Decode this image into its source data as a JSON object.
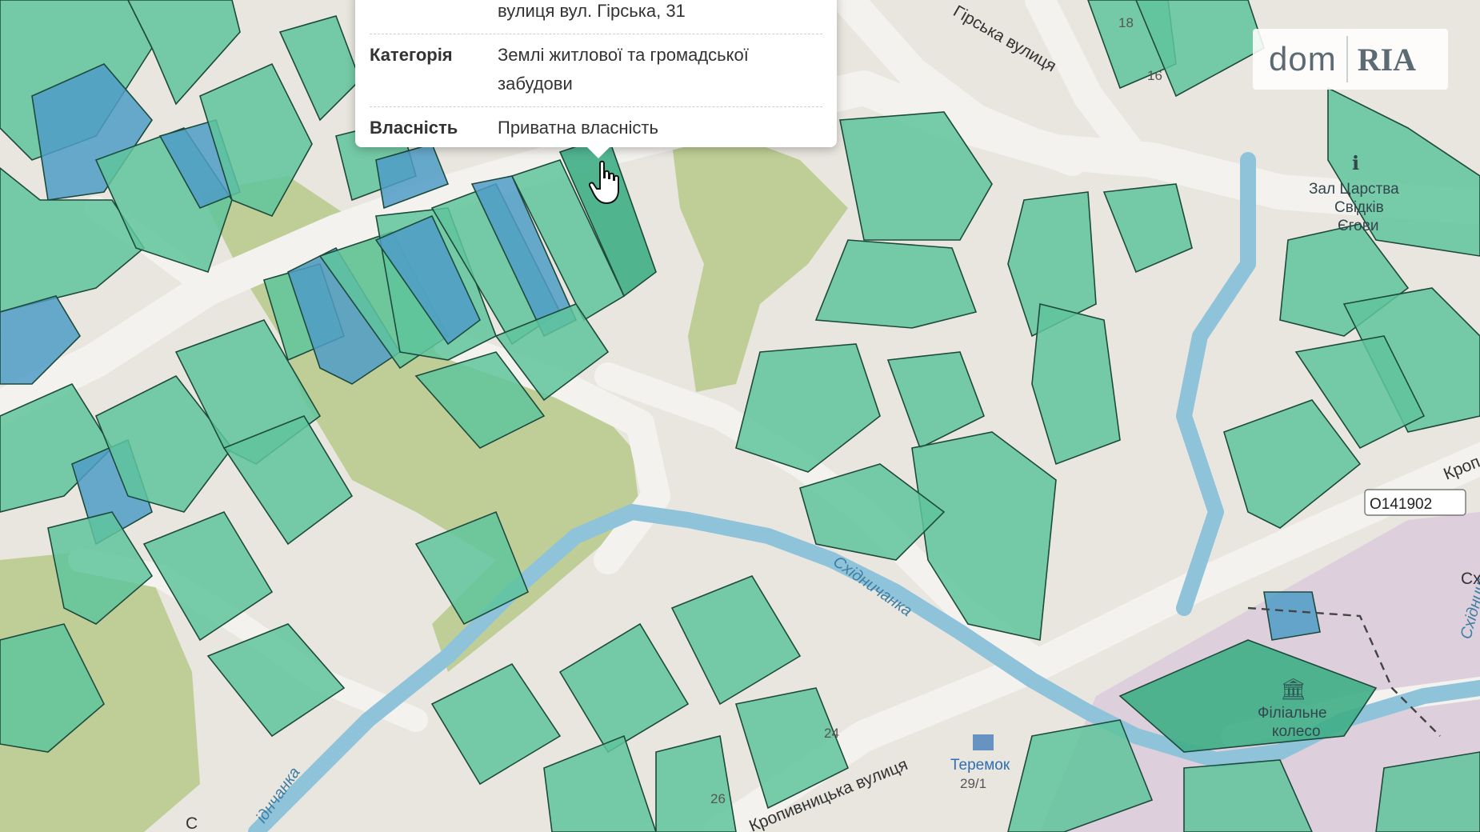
{
  "popup": {
    "rows": [
      {
        "key": "",
        "value": "вулиця вул. Гірська, 31"
      },
      {
        "key": "Категорія",
        "value": "Землі житлової та громадської забудови"
      },
      {
        "key": "Власність",
        "value": "Приватна власність"
      }
    ]
  },
  "logo": {
    "left": "dom",
    "right": "RIA"
  },
  "map": {
    "streets": [
      "Гірська вулиця",
      "Кропивницька вулиця",
      "Кроп"
    ],
    "rivers": [
      "Східничанка",
      "Східничанка"
    ],
    "river_fragment": "іднчанка",
    "road_badge": "О141902",
    "pois": [
      {
        "name_line1": "Зал Царства",
        "name_line2": "Свідків",
        "name_line3": "Єгови",
        "icon": "info-icon"
      },
      {
        "name_line1": "Філіальне",
        "name_line2": "колесо",
        "icon": "museum-icon"
      },
      {
        "name_line1": "Теремок",
        "number": "29/1",
        "icon": "hotel-icon"
      }
    ],
    "house_numbers": [
      "18",
      "16",
      "24",
      "26"
    ],
    "partial_labels": [
      "С",
      "Схі"
    ]
  },
  "colors": {
    "parcel": "#5fc49c",
    "parcel_blue": "#4f9cc7",
    "green_zone": "#b7c98a",
    "river": "#8fc3da",
    "base": "#e8e6df"
  }
}
